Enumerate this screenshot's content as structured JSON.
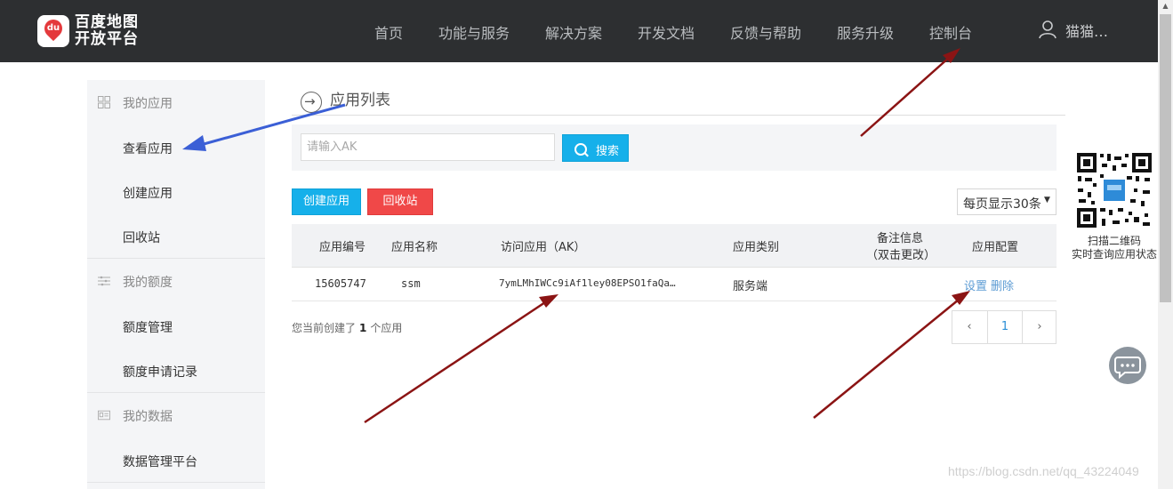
{
  "header": {
    "logo_line1": "百度地图",
    "logo_line2": "开放平台",
    "nav": [
      "首页",
      "功能与服务",
      "解决方案",
      "开发文档",
      "反馈与帮助",
      "服务升级",
      "控制台"
    ],
    "user_name": "猫猫…"
  },
  "sidebar": {
    "sections": [
      {
        "title": "我的应用",
        "icon": "grid-icon",
        "items": [
          "查看应用",
          "创建应用",
          "回收站"
        ]
      },
      {
        "title": "我的额度",
        "icon": "list-icon",
        "items": [
          "额度管理",
          "额度申请记录"
        ]
      },
      {
        "title": "我的数据",
        "icon": "id-card-icon",
        "items": [
          "数据管理平台"
        ]
      }
    ]
  },
  "main": {
    "title": "应用列表",
    "search": {
      "placeholder": "请输入AK",
      "button": "搜索"
    },
    "create_button": "创建应用",
    "recycle_button": "回收站",
    "page_size": "每页显示30条",
    "table": {
      "headers": [
        "应用编号",
        "应用名称",
        "访问应用（AK）",
        "应用类别",
        "备注信息",
        "（双击更改）",
        "应用配置"
      ],
      "rows": [
        {
          "id": "15605747",
          "name": "ssm",
          "ak": "7ymLMhIWCc9iAf1ley08EPSO1faQa…",
          "category": "服务端",
          "note": "",
          "actions": [
            "设置",
            "删除"
          ]
        }
      ]
    },
    "summary": {
      "prefix": "您当前创建了",
      "count": "1",
      "suffix": "个应用"
    },
    "pagination": {
      "prev": "‹",
      "current": "1",
      "next": "›"
    }
  },
  "qr": {
    "caption_line1": "扫描二维码",
    "caption_line2": "实时查询应用状态"
  },
  "watermark": "https://blog.csdn.net/qq_43224049",
  "colors": {
    "topbar": "#2d2f31",
    "primary": "#16b0ea",
    "danger": "#f04848",
    "annotation_arrow_red": "#8b1414",
    "annotation_arrow_blue": "#3b5fd6"
  }
}
